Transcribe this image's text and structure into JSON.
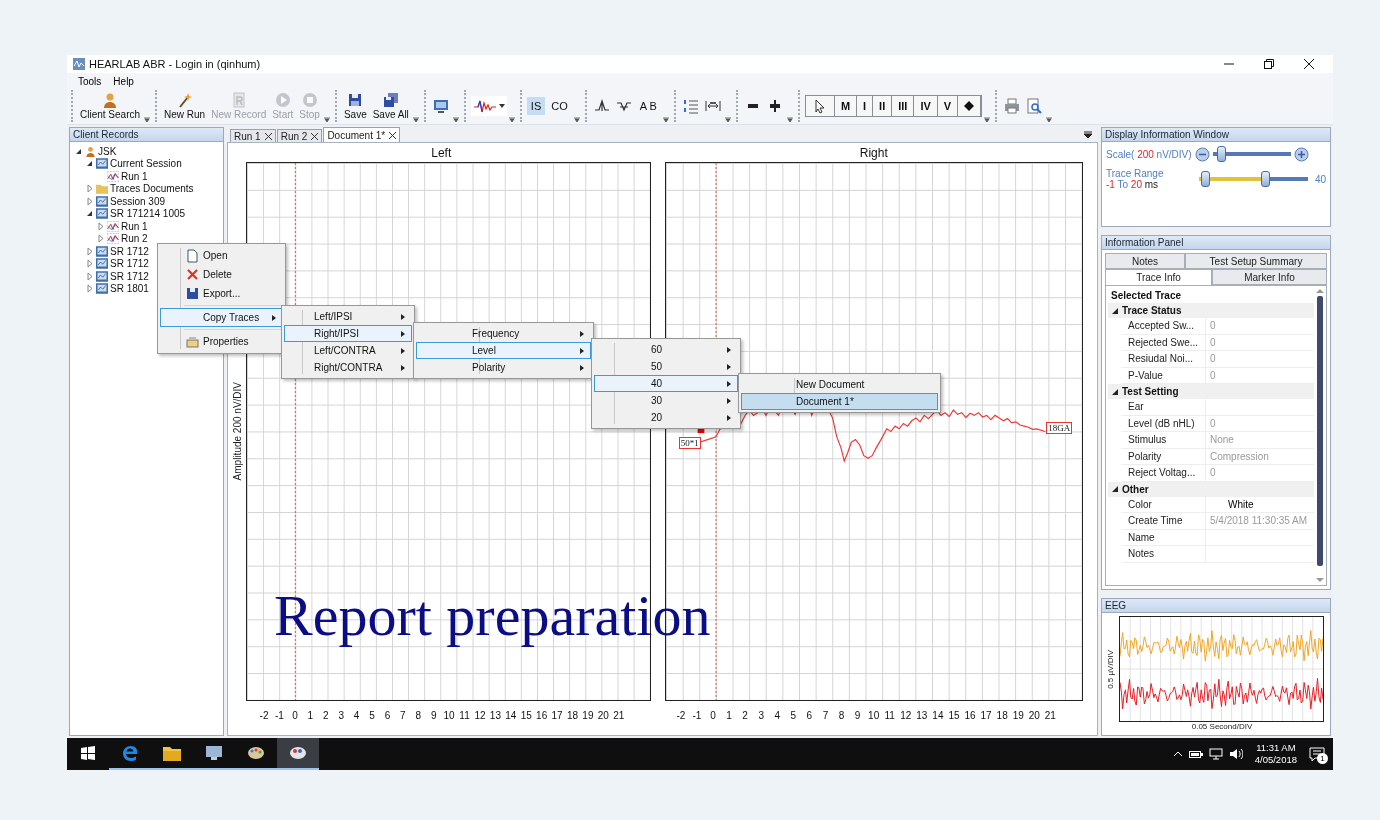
{
  "window": {
    "title": "HEARLAB ABR - Login in (qinhum)"
  },
  "menu": [
    "Tools",
    "Help"
  ],
  "toolbar": [
    {
      "kind": "plain",
      "items": [
        {
          "kind": "labeled",
          "label": "Client Search",
          "disabled": false
        }
      ]
    },
    {
      "kind": "plain",
      "items": [
        {
          "kind": "labeled",
          "label": "New Run",
          "disabled": false
        },
        {
          "kind": "labeled",
          "label": "New Record",
          "disabled": true
        },
        {
          "kind": "labeled",
          "label": "Start",
          "disabled": true
        },
        {
          "kind": "labeled",
          "label": "Stop",
          "disabled": true
        }
      ]
    },
    {
      "kind": "plain",
      "items": [
        {
          "kind": "labeled",
          "label": "Save",
          "disabled": false
        },
        {
          "kind": "labeled",
          "label": "Save All",
          "disabled": false
        }
      ]
    },
    {
      "kind": "plain",
      "items": [
        {
          "kind": "icon"
        }
      ]
    },
    {
      "kind": "plain",
      "items": [
        {
          "kind": "dropdown"
        }
      ]
    },
    {
      "kind": "plain",
      "items": [
        {
          "kind": "text",
          "label": "IS",
          "selected": true
        },
        {
          "kind": "text",
          "label": "CO",
          "selected": false
        }
      ]
    },
    {
      "kind": "plain",
      "items": [
        {
          "kind": "icon"
        },
        {
          "kind": "icon"
        },
        {
          "kind": "text",
          "label": "A B",
          "selected": false
        }
      ]
    },
    {
      "kind": "plain",
      "items": [
        {
          "kind": "icon"
        },
        {
          "kind": "icon"
        }
      ]
    },
    {
      "kind": "plain",
      "items": [
        {
          "kind": "icon"
        },
        {
          "kind": "icon"
        }
      ]
    },
    {
      "kind": "segmented",
      "items": [
        {
          "kind": "icon"
        },
        {
          "kind": "text",
          "label": "M",
          "selected": false
        },
        {
          "kind": "text",
          "label": "I",
          "selected": false
        },
        {
          "kind": "text",
          "label": "II",
          "selected": false
        },
        {
          "kind": "text",
          "label": "III",
          "selected": false
        },
        {
          "kind": "text",
          "label": "IV",
          "selected": false
        },
        {
          "kind": "text",
          "label": "V",
          "selected": false
        },
        {
          "kind": "icon"
        }
      ]
    },
    {
      "kind": "plain",
      "items": [
        {
          "kind": "icon"
        },
        {
          "kind": "icon"
        }
      ]
    }
  ],
  "client_records": {
    "title": "Client Records",
    "tree": [
      {
        "label": "JSK",
        "kind": "person",
        "expanded": true,
        "children": [
          {
            "label": "Current Session",
            "kind": "session",
            "expanded": true,
            "children": [
              {
                "label": "Run 1",
                "kind": "run"
              }
            ]
          },
          {
            "label": "Traces Documents",
            "kind": "folder",
            "expanded": false
          },
          {
            "label": "Session 309",
            "kind": "session",
            "expanded": false
          },
          {
            "label": "SR 171214 1005",
            "kind": "session",
            "expanded": true,
            "children": [
              {
                "label": "Run 1",
                "kind": "run",
                "expanded": false
              },
              {
                "label": "Run 2",
                "kind": "run",
                "expanded": false
              }
            ]
          },
          {
            "label": "SR 1712",
            "kind": "session",
            "expanded": false
          },
          {
            "label": "SR 1712",
            "kind": "session",
            "expanded": false
          },
          {
            "label": "SR 1712",
            "kind": "session",
            "expanded": false
          },
          {
            "label": "SR 1801",
            "kind": "session",
            "expanded": false
          }
        ]
      }
    ]
  },
  "context_menu": {
    "items": [
      {
        "label": "Open",
        "kind": "action",
        "selected": false
      },
      {
        "label": "Delete",
        "kind": "action",
        "selected": false
      },
      {
        "label": "Export...",
        "kind": "action",
        "selected": false
      },
      {
        "label": "Copy Traces",
        "kind": "submenu",
        "selected": true
      },
      {
        "label": "Properties",
        "kind": "action",
        "selected": false
      }
    ],
    "submenus": [
      {
        "items": [
          {
            "label": "Left/IPSI",
            "selected": false
          },
          {
            "label": "Right/IPSI",
            "selected": true
          },
          {
            "label": "Left/CONTRA",
            "selected": false
          },
          {
            "label": "Right/CONTRA",
            "selected": false
          }
        ]
      },
      {
        "items": [
          {
            "label": "Frequency",
            "selected": false
          },
          {
            "label": "Level",
            "selected": true
          },
          {
            "label": "Polarity",
            "selected": false
          }
        ]
      },
      {
        "items": [
          {
            "label": "60",
            "selected": false
          },
          {
            "label": "50",
            "selected": false
          },
          {
            "label": "40",
            "selected": true
          },
          {
            "label": "30",
            "selected": false
          },
          {
            "label": "20",
            "selected": false
          }
        ]
      },
      {
        "items": [
          {
            "label": "New Document",
            "kind": "action",
            "selected": false
          },
          {
            "label": "Document 1*",
            "kind": "action",
            "selected": true
          }
        ]
      }
    ]
  },
  "tabs": [
    {
      "label": "Run 1",
      "selected": false
    },
    {
      "label": "Run 2",
      "selected": false
    },
    {
      "label": "Document 1*",
      "selected": true
    }
  ],
  "plots": [
    {
      "title": "Left",
      "kind": "empty",
      "ylabel": "Amplitude 200 nV/DIV",
      "xticks": [
        "-2",
        "-1",
        "0",
        "1",
        "2",
        "3",
        "4",
        "5",
        "6",
        "7",
        "8",
        "9",
        "10",
        "11",
        "12",
        "13",
        "14",
        "15",
        "16",
        "17",
        "18",
        "19",
        "20",
        "21"
      ]
    },
    {
      "title": "Right",
      "kind": "trace",
      "trace_labels": [
        "50*1",
        "18GA"
      ],
      "xticks": [
        "-2",
        "-1",
        "0",
        "1",
        "2",
        "3",
        "4",
        "5",
        "6",
        "7",
        "8",
        "9",
        "10",
        "11",
        "12",
        "13",
        "14",
        "15",
        "16",
        "17",
        "18",
        "19",
        "20",
        "21"
      ]
    }
  ],
  "caption": "Report preparation",
  "display_window": {
    "title": "Display Information Window",
    "scale": {
      "prefix": "Scale(",
      "value": "200",
      "unit": "nV/DIV)",
      "level": 0.06
    },
    "trace_range": {
      "label": "Trace Range",
      "from": "-1",
      "to_word": "To",
      "to": "20",
      "unit": "ms",
      "level": 0.62,
      "end_label": "40"
    }
  },
  "info_panel": {
    "title": "Information Panel",
    "tab_rows": [
      [
        {
          "label": "Notes",
          "selected": false
        },
        {
          "label": "Test Setup Summary",
          "selected": false
        }
      ],
      [
        {
          "label": "Trace Info",
          "selected": true
        },
        {
          "label": "Marker Info",
          "selected": false
        }
      ]
    ],
    "heading": "Selected Trace",
    "categories": [
      {
        "label": "Trace Status",
        "expanded": true,
        "rows": [
          {
            "name": "Accepted Sw...",
            "value": "0",
            "readonly": true
          },
          {
            "name": "Rejected Swe...",
            "value": "0",
            "readonly": true
          },
          {
            "name": "Resiudal Noi...",
            "value": "0",
            "readonly": true
          },
          {
            "name": "P-Value",
            "value": "0",
            "readonly": true
          }
        ]
      },
      {
        "label": "Test Setting",
        "expanded": true,
        "rows": [
          {
            "name": "Ear"
          },
          {
            "name": "Level (dB nHL)",
            "value": "0",
            "readonly": true
          },
          {
            "name": "Stimulus",
            "value": "None",
            "readonly": true
          },
          {
            "name": "Polarity",
            "value": "Compression",
            "readonly": true
          },
          {
            "name": "Reject Voltag...",
            "value": "0",
            "readonly": true
          }
        ]
      },
      {
        "label": "Other",
        "expanded": true,
        "rows": [
          {
            "name": "Color",
            "value": "White",
            "readonly": false
          },
          {
            "name": "Create Time",
            "value": "5/4/2018 11:30:35 AM",
            "readonly": true
          },
          {
            "name": "Name"
          },
          {
            "name": "Notes"
          }
        ]
      }
    ]
  },
  "eeg": {
    "title": "EEG",
    "ylabel": "0.5 µV/DIV",
    "xlabel": "0.05 Second/DIV"
  },
  "taskbar": {
    "apps": [
      {
        "running": true,
        "selected": false
      },
      {
        "running": true,
        "selected": false
      },
      {
        "running": true,
        "selected": false
      },
      {
        "running": true,
        "selected": false
      },
      {
        "running": true,
        "selected": true
      }
    ],
    "time": "11:31 AM",
    "date": "4/05/2018",
    "notifications": "1"
  }
}
